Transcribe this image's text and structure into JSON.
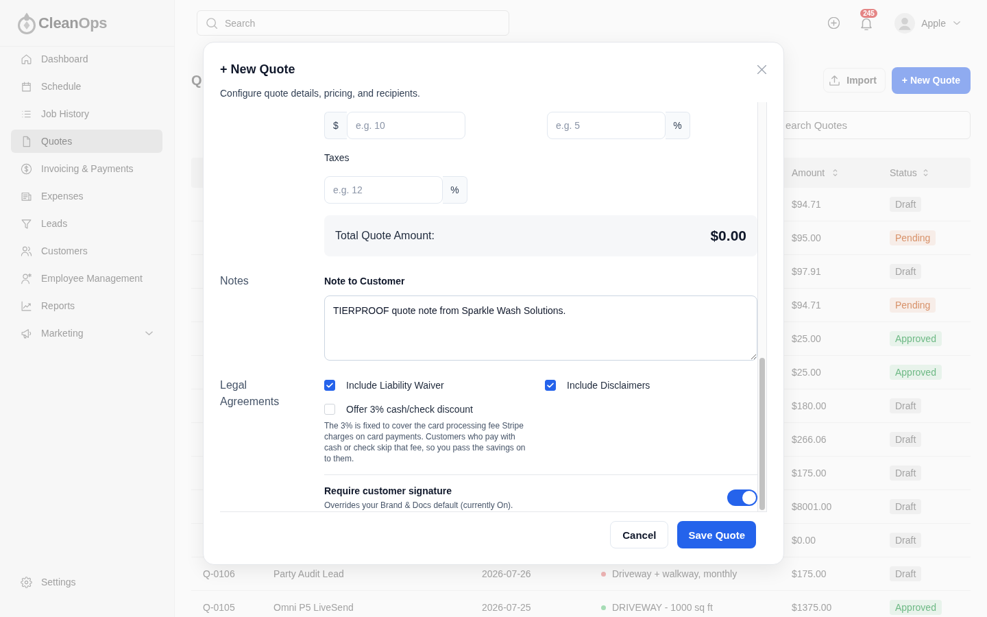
{
  "sidebar": {
    "logo": {
      "primary": "Clean",
      "secondary": "Ops"
    },
    "items": [
      {
        "label": "Dashboard",
        "selected": false,
        "kind": "link"
      },
      {
        "label": "Schedule",
        "selected": false,
        "kind": "link"
      },
      {
        "label": "Job History",
        "selected": false,
        "kind": "link"
      },
      {
        "label": "Quotes",
        "selected": true,
        "kind": "link"
      },
      {
        "label": "Invoicing & Payments",
        "selected": false,
        "kind": "link"
      },
      {
        "label": "Expenses",
        "selected": false,
        "kind": "link"
      },
      {
        "label": "Leads",
        "selected": false,
        "kind": "link"
      },
      {
        "label": "Customers",
        "selected": false,
        "kind": "link"
      },
      {
        "label": "Employee Management",
        "selected": false,
        "kind": "link"
      },
      {
        "label": "Reports",
        "selected": false,
        "kind": "link"
      },
      {
        "label": "Marketing",
        "selected": false,
        "kind": "group",
        "expanded": false
      }
    ],
    "footer_item": {
      "label": "Settings"
    }
  },
  "topbar": {
    "search": {
      "placeholder": "Search"
    },
    "notifications": {
      "count": "245"
    },
    "user": {
      "name": "Apple"
    }
  },
  "page": {
    "title": "Q",
    "actions": [
      {
        "label": "Import",
        "kind": "secondary"
      },
      {
        "label": "+ New Quote",
        "kind": "primary"
      }
    ],
    "search": {
      "placeholder": "earch Quotes"
    },
    "table": {
      "columns": [
        {
          "label": "Amount"
        },
        {
          "label": "Status"
        }
      ],
      "rows": [
        {
          "amount": "$94.71",
          "status": {
            "label": "Draft",
            "color": "#a3a3a3"
          }
        },
        {
          "amount": "$95.00",
          "status": {
            "label": "Pending",
            "color": "#d8926a"
          }
        },
        {
          "amount": "$97.91",
          "status": {
            "label": "Draft",
            "color": "#a3a3a3"
          }
        },
        {
          "amount": "$94.71",
          "status": {
            "label": "Pending",
            "color": "#d8926a"
          }
        },
        {
          "amount": "$25.00",
          "status": {
            "label": "Approved",
            "color": "#6fba86"
          }
        },
        {
          "amount": "$25.00",
          "status": {
            "label": "Approved",
            "color": "#6fba86"
          }
        },
        {
          "amount": "$180.00",
          "status": {
            "label": "Draft",
            "color": "#a3a3a3"
          }
        },
        {
          "amount": "$266.06",
          "status": {
            "label": "Draft",
            "color": "#a3a3a3"
          }
        },
        {
          "amount": "$175.00",
          "status": {
            "label": "Draft",
            "color": "#a3a3a3"
          }
        },
        {
          "amount": "$8001.00",
          "status": {
            "label": "Draft",
            "color": "#a3a3a3"
          }
        },
        {
          "amount": "$0.00",
          "status": {
            "label": "Draft",
            "color": "#a3a3a3"
          }
        },
        {
          "column_1": "Q-0106",
          "column_2": "Party Audit Lead",
          "column_3": "2026-07-26",
          "column_4": {
            "text": "Driveway + walkway, monthly",
            "color": "#efb5b5"
          },
          "amount": "$175.00",
          "status": {
            "label": "Draft",
            "color": "#a3a3a3"
          }
        },
        {
          "column_1": "Q-0105",
          "column_2": "Omni P5 LiveSend",
          "column_3": "2026-07-25",
          "column_4": {
            "text": "DRIVEWAY - 1000 sq ft",
            "color": "#a6dcb5"
          },
          "amount": "$1375.00",
          "status": {
            "label": "Approved",
            "color": "#6fba86"
          }
        }
      ]
    }
  },
  "dialog": {
    "title": "+ New Quote",
    "subtitle": "Configure quote details, pricing, and recipients.",
    "pricing": {
      "fields": [
        {
          "prefix": "$",
          "placeholder": "e.g. 10"
        },
        {
          "placeholder": "e.g. 5",
          "suffix": "%"
        }
      ],
      "taxes": {
        "label": "Taxes",
        "placeholder": "e.g. 12",
        "suffix": "%"
      },
      "total": {
        "label": "Total Quote Amount:",
        "value": "$0.00"
      }
    },
    "notes": {
      "section_label": "Notes",
      "label": "Note to Customer",
      "value": "TIERPROOF quote note from Sparkle Wash Solutions."
    },
    "legal": {
      "section_label": "Legal Agreements",
      "options": [
        {
          "label": "Include Liability Waiver",
          "checked": true
        },
        {
          "label": "Include Disclaimers",
          "checked": true
        },
        {
          "label": "Offer 3% cash/check discount",
          "checked": false,
          "help": "The 3% is fixed to cover the card processing fee Stripe charges on card payments. Customers who pay with cash or check skip that fee, so you pass the savings on to them."
        }
      ],
      "signature": {
        "label": "Require customer signature",
        "hint": "Overrides your Brand & Docs default (currently On).",
        "on": true
      }
    },
    "buttons": [
      {
        "label": "Cancel",
        "kind": "secondary"
      },
      {
        "label": "Save Quote",
        "kind": "primary"
      }
    ]
  }
}
